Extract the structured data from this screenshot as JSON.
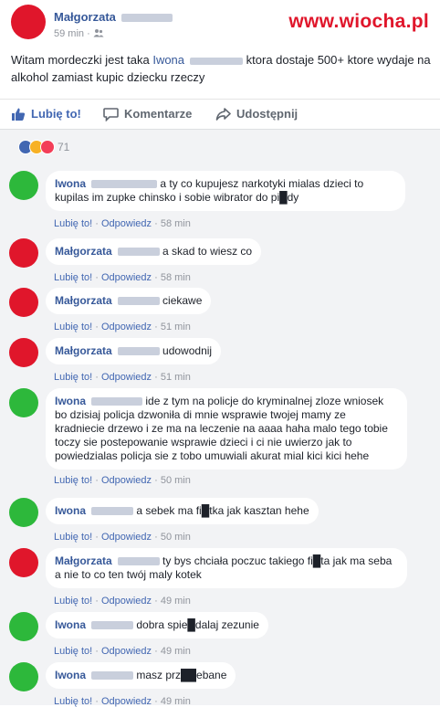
{
  "post": {
    "author": "Małgorzata",
    "time": "59 min",
    "separator": "·",
    "privacy_icon": "friends-icon",
    "text_before": "Witam mordeczki jest taka ",
    "tagged_name": "Iwona",
    "text_after": " ktora dostaje 500+ ktore wydaje na alkohol zamiast kupic dziecku rzeczy",
    "watermark": "www.wiocha.pl",
    "actions": {
      "like": "Lubię to!",
      "comment": "Komentarze",
      "share": "Udostępnij"
    },
    "reactions": {
      "count": "71",
      "icons": [
        "like-icon",
        "haha-icon",
        "love-icon"
      ]
    }
  },
  "comment_actions": {
    "like": "Lubię to!",
    "reply": "Odpowiedz",
    "sep": "·"
  },
  "comments": [
    {
      "author": "Iwona",
      "text": "a ty co kupujesz narkotyki mialas dzieci to kupilas im zupke chinsko i sobie wibrator do pi█dy",
      "time": "58 min",
      "color": "#2db83b"
    },
    {
      "author": "Małgorzata",
      "text": "a skad to wiesz co",
      "time": "58 min",
      "color": "#e0162b"
    },
    {
      "author": "Małgorzata",
      "text": "ciekawe",
      "time": "51 min",
      "color": "#e0162b"
    },
    {
      "author": "Małgorzata",
      "text": "udowodnij",
      "time": "51 min",
      "color": "#e0162b"
    },
    {
      "author": "Iwona",
      "text": "ide z tym na policje do kryminalnej zloze wniosek bo dzisiaj policja dzwoniła di mnie wsprawie twojej mamy ze kradniecie drzewo i ze ma na leczenie na aaaa haha malo tego tobie toczy sie postepowanie wsprawie dzieci i ci nie uwierzo jak to powiedzialas policja sie z tobo umuwiali akurat mial kici kici hehe",
      "time": "50 min",
      "color": "#2db83b"
    },
    {
      "author": "Iwona",
      "text": "a sebek ma fi█tka jak kasztan hehe",
      "time": "50 min",
      "color": "#2db83b"
    },
    {
      "author": "Małgorzata",
      "text": "ty bys chciała poczuc takiego fi█ta jak ma seba a nie to co ten twój maly kotek",
      "time": "49 min",
      "color": "#e0162b"
    },
    {
      "author": "Iwona",
      "text": "dobra spie█dalaj zezunie",
      "time": "49 min",
      "color": "#2db83b"
    },
    {
      "author": "Iwona",
      "text": "masz prz██ebane",
      "time": "49 min",
      "color": "#2db83b"
    }
  ]
}
